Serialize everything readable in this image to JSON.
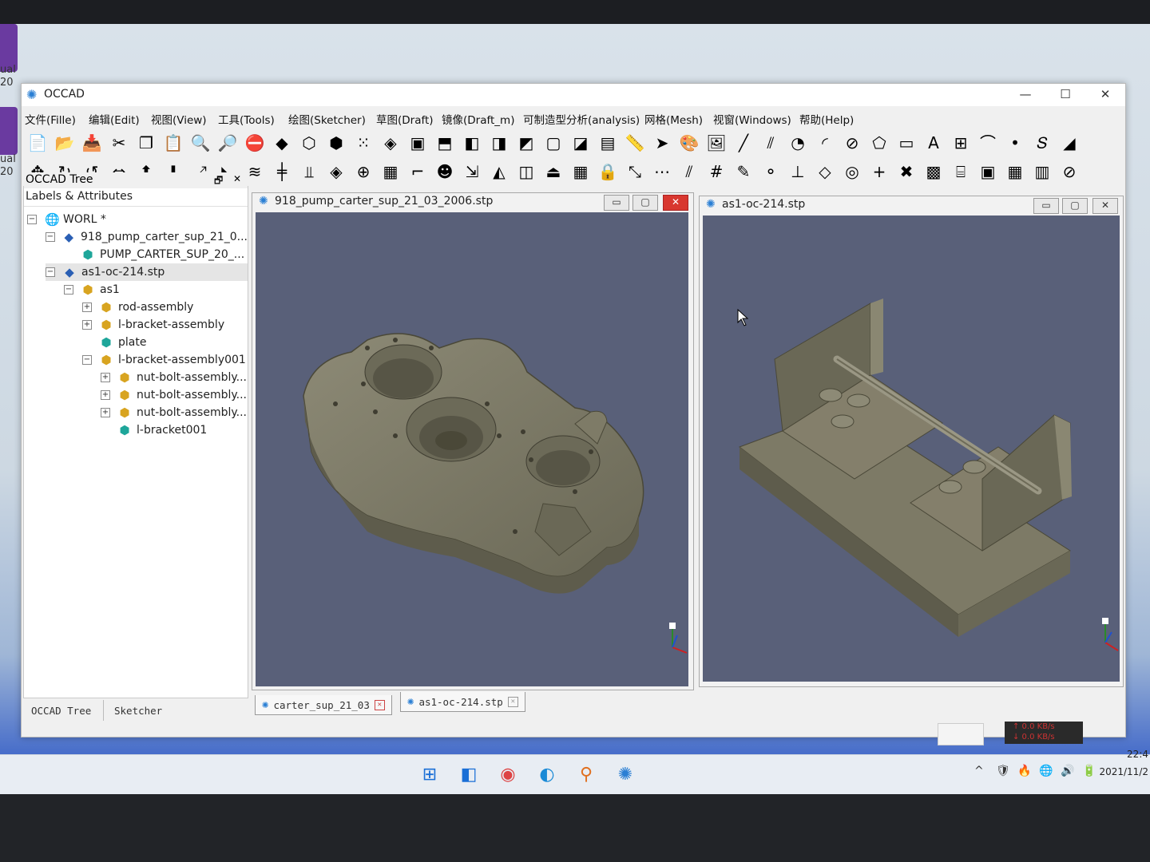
{
  "app": {
    "title": "OCCAD"
  },
  "window_controls": {
    "minimize": "—",
    "maximize": "☐",
    "close": "✕"
  },
  "menu": [
    "文件(Fille)",
    "编辑(Edit)",
    "视图(View)",
    "工具(Tools)",
    "绘图(Sketcher)",
    "草图(Draft)",
    "镜像(Draft_m)",
    "可制造型分析(analysis)",
    "网格(Mesh)",
    "视窗(Windows)",
    "帮助(Help)"
  ],
  "toolbar1_icons": [
    "new-file",
    "open-folder",
    "save",
    "cut",
    "copy",
    "paste",
    "zoom-fit",
    "zoom",
    "no-entry",
    "solid-cube",
    "wire-cube",
    "wire-cube-2",
    "points",
    "iso-cube",
    "view-front",
    "view-top",
    "view-right",
    "view-left",
    "view-iso",
    "view-bottom",
    "view-rear",
    "view-box",
    "measure",
    "pointer",
    "palette",
    "image",
    "line",
    "polyline",
    "circle",
    "arc",
    "ellipse",
    "polygon",
    "rectangle",
    "text",
    "dimension",
    "bezier",
    "point",
    "spline",
    "shape"
  ],
  "toolbar2_icons": [
    "move",
    "rotate",
    "undo-arc",
    "mirror",
    "arrow-up",
    "arrow-down",
    "scale",
    "fillet",
    "wave",
    "align-center",
    "align-bottom",
    "layers",
    "sphere-grid",
    "grid",
    "step",
    "head",
    "import",
    "mirror-tri",
    "half-tri",
    "extrude",
    "grid2",
    "lock",
    "link",
    "dots",
    "diagonal",
    "hash",
    "pencil",
    "node",
    "perpendicular",
    "diamond",
    "target",
    "plus",
    "cross",
    "box-3d",
    "stairs",
    "screen",
    "cube-red",
    "cube-red-2",
    "ban"
  ],
  "toolbar_glyphs": {
    "t1": [
      "📄",
      "📂",
      "📥",
      "✂",
      "❐",
      "📋",
      "🔍",
      "🔎",
      "⛔",
      "◆",
      "⬡",
      "⬢",
      "⁙",
      "◈",
      "▣",
      "⬒",
      "◧",
      "◨",
      "◩",
      "▢",
      "◪",
      "▤",
      "📏",
      "➤",
      "🎨",
      "🖼",
      "╱",
      "⫽",
      "◔",
      "◜",
      "⊘",
      "⬠",
      "▭",
      "A",
      "⊞",
      "⌒",
      "•",
      "𝑆",
      "◢"
    ],
    "t2": [
      "✥",
      "↻",
      "↺",
      "⇔",
      "⬆",
      "⬇",
      "⤢",
      "◣",
      "≋",
      "╪",
      "⫫",
      "◈",
      "⊕",
      "▦",
      "⌐",
      "☻",
      "⇲",
      "◭",
      "◫",
      "⏏",
      "▦",
      "🔒",
      "⤡",
      "⋯",
      "⫽",
      "#",
      "✎",
      "⚬",
      "⊥",
      "◇",
      "◎",
      "+",
      "✖",
      "▩",
      "⌸",
      "▣",
      "▦",
      "▥",
      "⊘"
    ]
  },
  "tree": {
    "panel_title": "OCCAD Tree",
    "header": "Labels & Attributes",
    "float_icon": "🗗",
    "close_icon": "✕",
    "rows": [
      {
        "label": "WORL *",
        "level": 0,
        "expander": "⊟",
        "icon": "world"
      },
      {
        "label": "918_pump_carter_sup_21_0...",
        "level": 1,
        "expander": "⊟",
        "icon": "doc"
      },
      {
        "label": "PUMP_CARTER_SUP_20_...",
        "level": 2,
        "expander": "",
        "icon": "part"
      },
      {
        "label": "as1-oc-214.stp",
        "level": 1,
        "expander": "⊟",
        "icon": "doc",
        "selected": true
      },
      {
        "label": "as1",
        "level": 2,
        "expander": "⊟",
        "icon": "asm"
      },
      {
        "label": "rod-assembly",
        "level": 3,
        "expander": "⊞",
        "icon": "asm"
      },
      {
        "label": "l-bracket-assembly",
        "level": 3,
        "expander": "⊞",
        "icon": "asm"
      },
      {
        "label": "plate",
        "level": 3,
        "expander": "",
        "icon": "part"
      },
      {
        "label": "l-bracket-assembly001",
        "level": 3,
        "expander": "⊟",
        "icon": "asm"
      },
      {
        "label": "nut-bolt-assembly...",
        "level": 4,
        "expander": "⊞",
        "icon": "asm"
      },
      {
        "label": "nut-bolt-assembly...",
        "level": 4,
        "expander": "⊞",
        "icon": "asm"
      },
      {
        "label": "nut-bolt-assembly...",
        "level": 4,
        "expander": "⊞",
        "icon": "asm"
      },
      {
        "label": "l-bracket001",
        "level": 4,
        "expander": "",
        "icon": "part"
      }
    ],
    "tabs": [
      "OCCAD Tree",
      "Sketcher"
    ]
  },
  "viewers": [
    {
      "title": "918_pump_carter_sup_21_03_2006.stp",
      "tab": "carter_sup_21_03"
    },
    {
      "title": "as1-oc-214.stp",
      "tab": "as1-oc-214.stp"
    }
  ],
  "viewer_buttons": {
    "min": "▭",
    "max": "▢",
    "close": "✕"
  },
  "taskbar": {
    "icons": [
      "⊞",
      "◧",
      "◉",
      "◐",
      "⚲",
      "✺"
    ]
  },
  "tray": {
    "icons": [
      "^",
      "🛡",
      "🔥",
      "🌐",
      "🔊",
      "🔋"
    ],
    "time": "22:4",
    "date": "2021/11/2",
    "net_up": "↑ 0.0 KB/s",
    "net_down": "↓ 0.0 KB/s"
  },
  "desktop": {
    "icon_label_1": "ual",
    "icon_label_1b": "20",
    "icon_label_2": "ual",
    "icon_label_2b": "20"
  },
  "colors": {
    "viewport_bg": "#596079",
    "model": "#7d7a66",
    "accent": "#2a7fd4"
  }
}
